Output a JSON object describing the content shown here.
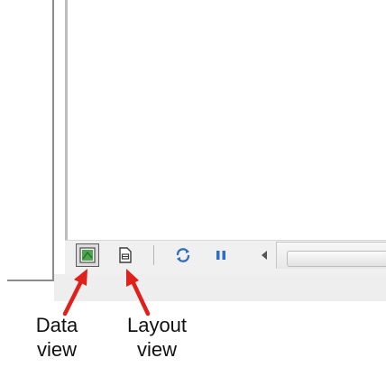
{
  "annotations": {
    "data_view": {
      "line1": "Data",
      "line2": "view"
    },
    "layout_view": {
      "line1": "Layout",
      "line2": "view"
    }
  },
  "toolbar": {
    "buttons": [
      {
        "name": "data-view-button",
        "icon": "data-view-icon",
        "pressed": true
      },
      {
        "name": "layout-view-button",
        "icon": "layout-view-icon",
        "pressed": false
      },
      {
        "name": "refresh-button",
        "icon": "refresh-icon",
        "pressed": false
      },
      {
        "name": "pause-drawing-button",
        "icon": "pause-icon",
        "pressed": false
      },
      {
        "name": "scroll-left-button",
        "icon": "triangle-left-icon",
        "pressed": false
      }
    ]
  },
  "colors": {
    "annotation_arrow": "#e0201b",
    "refresh_icon": "#2f6fc0",
    "pause_icon": "#2f6fc0",
    "data_view_icon": "#4ca64c"
  }
}
